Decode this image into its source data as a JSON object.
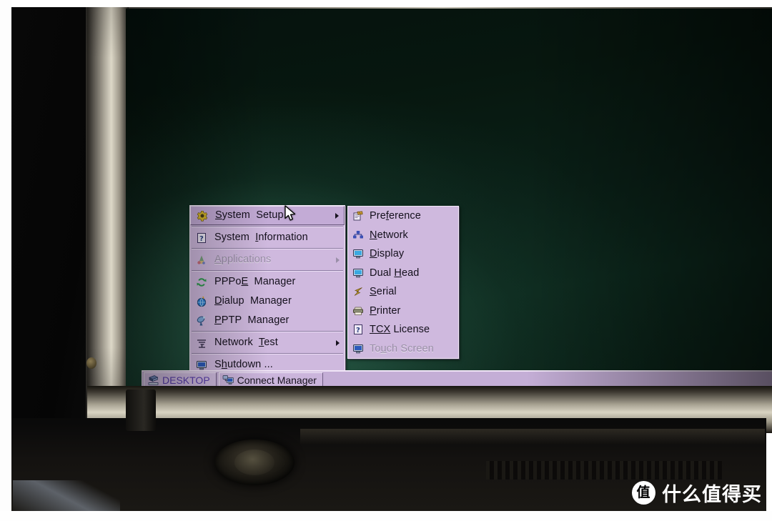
{
  "photo": {
    "subject": "thin-client-terminal-photo",
    "watermark": {
      "badge": "值",
      "text": "什么值得买"
    }
  },
  "desktop": {
    "background_color": "#0a2017"
  },
  "main_menu": {
    "items": [
      {
        "label": "System  Setup",
        "icon": "gear-icon",
        "accelerator": "S",
        "submenu": true,
        "selected": true,
        "disabled": false
      },
      {
        "label": "System  Information",
        "icon": "question-box-icon",
        "accelerator": "I",
        "submenu": false,
        "selected": false,
        "disabled": false
      },
      {
        "separator_before": true,
        "label": "Applications",
        "icon": "applications-icon",
        "accelerator": "A",
        "submenu": true,
        "selected": false,
        "disabled": true
      },
      {
        "separator_before": true,
        "label": "PPPoE  Manager",
        "icon": "pppoe-icon",
        "accelerator": "E",
        "submenu": false,
        "selected": false,
        "disabled": false
      },
      {
        "label": "Dialup  Manager",
        "icon": "dialup-globe-icon",
        "accelerator": "D",
        "submenu": false,
        "selected": false,
        "disabled": false
      },
      {
        "label": "PPTP  Manager",
        "icon": "pptp-dish-icon",
        "accelerator": "P",
        "submenu": false,
        "selected": false,
        "disabled": false
      },
      {
        "separator_before": true,
        "label": "Network  Test",
        "icon": "network-test-icon",
        "accelerator": "T",
        "submenu": true,
        "selected": false,
        "disabled": false
      },
      {
        "separator_before": true,
        "label": "Shutdown ...",
        "icon": "monitor-icon",
        "accelerator": "h",
        "submenu": false,
        "selected": false,
        "disabled": false
      }
    ]
  },
  "sub_menu": {
    "parent": "System  Setup",
    "items": [
      {
        "label": "Preference",
        "icon": "preference-clipboard-icon",
        "accelerator": "f",
        "disabled": false
      },
      {
        "label": "Network",
        "icon": "network-icon",
        "accelerator": "N",
        "disabled": false
      },
      {
        "label": "Display",
        "icon": "display-monitor-icon",
        "accelerator": "D",
        "disabled": false
      },
      {
        "label": "Dual Head",
        "icon": "dual-head-monitor-icon",
        "accelerator": "H",
        "disabled": false
      },
      {
        "label": "Serial",
        "icon": "serial-port-icon",
        "accelerator": "S",
        "disabled": false
      },
      {
        "label": "Printer",
        "icon": "printer-icon",
        "accelerator": "P",
        "disabled": false
      },
      {
        "label": "TCX License",
        "icon": "question-box-icon",
        "accelerator": "TCX",
        "disabled": false
      },
      {
        "label": "Touch Screen",
        "icon": "touch-screen-icon",
        "accelerator": "u",
        "disabled": true
      }
    ]
  },
  "taskbar": {
    "buttons": [
      {
        "label": "DESKTOP",
        "icon": "desktop-icon",
        "active": true
      },
      {
        "label": "Connect Manager",
        "icon": "connect-manager-icon",
        "active": false
      }
    ]
  },
  "colors": {
    "menu_background": "#cfb9de",
    "menu_text": "#14101c",
    "menu_disabled_text": "#9a8fa8",
    "taskbar_background": "#c4aed6",
    "taskbar_active_text": "#5b3fb0",
    "screen_background": "#0a2017",
    "bezel": "#d8d3c2"
  }
}
